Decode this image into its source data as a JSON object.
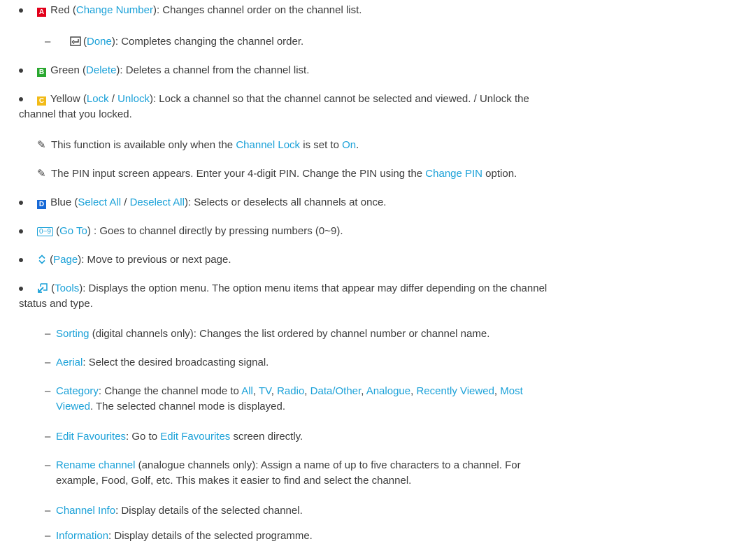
{
  "items": {
    "red": {
      "color_key": "A",
      "color_name": "Red",
      "action": "Change Number",
      "desc": ": Changes channel order on the channel list.",
      "sub_done": {
        "action": "Done",
        "desc": ": Completes changing the channel order."
      }
    },
    "green": {
      "color_key": "B",
      "color_name": "Green",
      "action": "Delete",
      "desc": ": Deletes a channel from the channel list."
    },
    "yellow": {
      "color_key": "C",
      "color_name": "Yellow",
      "action1": "Lock",
      "sep": " / ",
      "action2": "Unlock",
      "desc_line1": ": Lock a channel so that the channel cannot be selected and viewed. / Unlock the",
      "desc_line2": "channel that you locked.",
      "note1": {
        "pre": "This function is available only when the ",
        "link1": "Channel Lock",
        "mid": " is set to ",
        "link2": "On",
        "post": "."
      },
      "note2": {
        "pre": "The PIN input screen appears. Enter your 4-digit PIN. Change the PIN using the ",
        "link": "Change PIN",
        "post": " option."
      }
    },
    "blue": {
      "color_key": "D",
      "color_name": "Blue",
      "action1": "Select All",
      "sep": " / ",
      "action2": "Deselect All",
      "desc": ": Selects or deselects all channels at once."
    },
    "goto": {
      "key": "0~9",
      "action": "Go To",
      "desc": " : Goes to channel directly by pressing numbers (0~9)."
    },
    "page": {
      "action": "Page",
      "desc": ": Move to previous or next page."
    },
    "tools": {
      "action": "Tools",
      "desc_line1": ": Displays the option menu. The option menu items that appear may differ depending on the channel",
      "desc_line2": "status and type.",
      "options": {
        "sorting": {
          "label": "Sorting",
          "desc": " (digital channels only): Changes the list ordered by channel number or channel name."
        },
        "aerial": {
          "label": "Aerial",
          "desc": ": Select the desired broadcasting signal."
        },
        "category": {
          "label": "Category",
          "pre": ": Change the channel mode to ",
          "modes": [
            "All",
            "TV",
            "Radio",
            "Data/Other",
            "Analogue",
            "Recently Viewed",
            "Most",
            "Viewed"
          ],
          "post": ". The selected channel mode is displayed."
        },
        "edit_fav": {
          "label": "Edit Favourites",
          "pre": ": Go to ",
          "link": "Edit Favourites",
          "post": " screen directly."
        },
        "rename": {
          "label": "Rename channel",
          "desc_line1": " (analogue channels only): Assign a name of up to five characters to a channel. For",
          "desc_line2": "example, Food, Golf, etc. This makes it easier to find and select the channel."
        },
        "channel_info": {
          "label": "Channel Info",
          "desc": ": Display details of the selected channel."
        },
        "information": {
          "label": "Information",
          "desc": ": Display details of the selected programme."
        }
      }
    }
  },
  "colors": {
    "link": "#1ba1d8",
    "text": "#3c3c3c",
    "red": "#e2001a",
    "green": "#2aa830",
    "yellow": "#f2bb18",
    "blue": "#1769d6"
  },
  "icons": {
    "note": "pencil-note-icon",
    "done": "done-enter-icon",
    "page": "page-up-down-icon",
    "tools": "tools-icon"
  }
}
